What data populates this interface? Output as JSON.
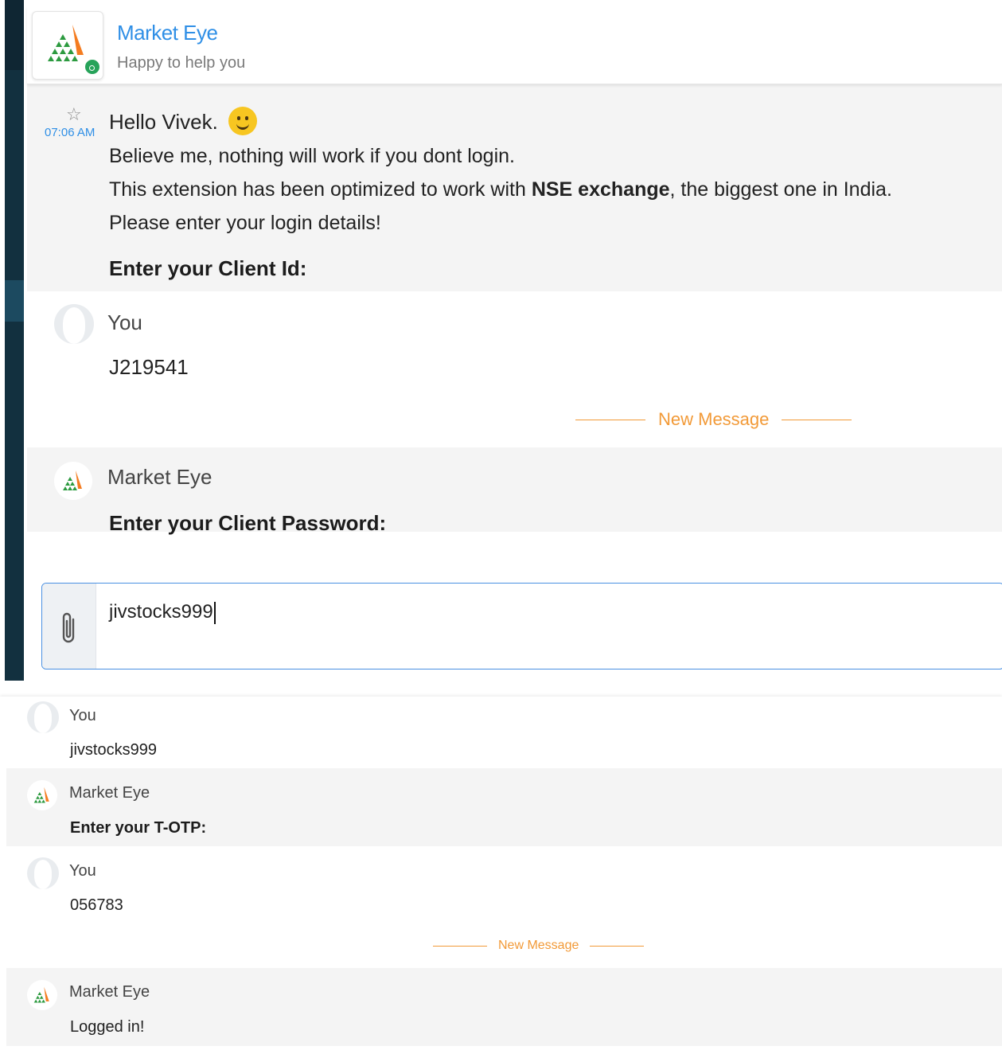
{
  "header": {
    "title": "Market Eye",
    "subtitle": "Happy to help you",
    "logo_icon": "market-eye-triangle-logo",
    "status_color": "#27a35a"
  },
  "greeting": {
    "time": "07:06 AM",
    "line1": "Hello Vivek.",
    "line2": "Believe me, nothing will work if you dont login.",
    "line3_pre": "This extension has been optimized to work with ",
    "line3_bold": "NSE exchange",
    "line3_post": ", the biggest one in India.",
    "line4": "Please enter your login details!",
    "prompt": "Enter your Client Id:"
  },
  "top_chat": {
    "you_name": "You",
    "you_text": "J219541",
    "new_message": "New Message",
    "bot_name": "Market Eye",
    "bot_text": "Enter your Client Password:"
  },
  "composer": {
    "value": "jivstocks999",
    "attach_icon": "paperclip-icon",
    "border_color": "#4a90e2"
  },
  "bottom_chat": {
    "messages": [
      {
        "sender": "You",
        "text": "jivstocks999"
      },
      {
        "sender": "Market Eye",
        "text": "Enter your T-OTP:"
      },
      {
        "sender": "You",
        "text": "056783"
      },
      {
        "sender": "Market Eye",
        "text": "Logged in!"
      }
    ],
    "new_message": "New Message"
  },
  "colors": {
    "accent_blue": "#2f8fe6",
    "new_message_orange": "#f29a38",
    "sidebar": "#12303f"
  }
}
